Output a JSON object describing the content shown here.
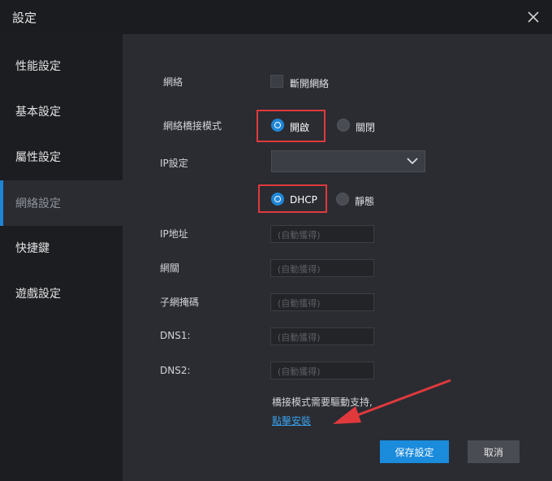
{
  "window": {
    "title": "設定"
  },
  "sidebar": {
    "items": [
      {
        "label": "性能設定",
        "active": false
      },
      {
        "label": "基本設定",
        "active": false
      },
      {
        "label": "屬性設定",
        "active": false
      },
      {
        "label": "網絡設定",
        "active": true
      },
      {
        "label": "快捷鍵",
        "active": false
      },
      {
        "label": "遊戲設定",
        "active": false
      }
    ]
  },
  "network": {
    "label": "網絡",
    "disconnect_label": "斷開網絡",
    "disconnect_checked": false,
    "bridge_label": "網絡橋接模式",
    "bridge_on_label": "開啟",
    "bridge_off_label": "關閉",
    "bridge_selected": "開啟",
    "ip_setting_label": "IP設定",
    "ip_setting_value": "",
    "dhcp_label": "DHCP",
    "static_label": "靜態",
    "ip_mode_selected": "DHCP",
    "fields": [
      {
        "label": "IP地址",
        "placeholder": "(自動獲得)"
      },
      {
        "label": "網關",
        "placeholder": "(自動獲得)"
      },
      {
        "label": "子網掩碼",
        "placeholder": "(自動獲得)"
      },
      {
        "label": "DNS1:",
        "placeholder": "(自動獲得)"
      },
      {
        "label": "DNS2:",
        "placeholder": "(自動獲得)"
      }
    ],
    "driver_note": "橋接模式需要驅動支持,",
    "install_link": "點擊安裝"
  },
  "buttons": {
    "save": "保存設定",
    "cancel": "取消"
  },
  "colors": {
    "accent": "#1f86d6",
    "highlight": "#e0393c",
    "link": "#3aa0e8"
  }
}
